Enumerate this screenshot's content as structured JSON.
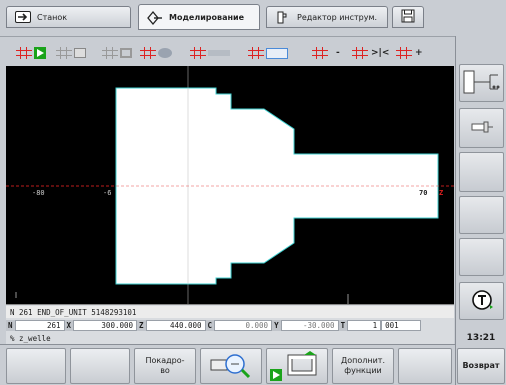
{
  "tabs": [
    {
      "label": "Станок"
    },
    {
      "label": "Моделирование"
    },
    {
      "label": "Редактор инструм."
    }
  ],
  "toolbar": {
    "items": [
      {
        "label": ""
      },
      {
        "label": ""
      },
      {
        "label": ""
      },
      {
        "label": ""
      },
      {
        "label": ""
      },
      {
        "label": ""
      },
      {
        "label": "-"
      },
      {
        "label": ">|<"
      },
      {
        "label": "+"
      }
    ]
  },
  "canvas": {
    "axis_left_label": "-80",
    "axis_mid_label": "-6",
    "axis_right_label": "70",
    "axis_z_label": "Z"
  },
  "status": {
    "line1": "N 261 END_OF_UNIT 5148293101",
    "n_label": "N",
    "n_value": "261",
    "x_label": "X",
    "x_value": "300.000",
    "z_label": "Z",
    "z_value": "440.000",
    "c_label": "C",
    "c_value": "0.000",
    "y_label": "Y",
    "y_value": "-30.000",
    "t_label": "T",
    "t_value": "1",
    "t_extra": "001",
    "line3": "% z_welle"
  },
  "softkeys": {
    "frame_by_frame": "Покадро-\nво",
    "extra_functions": "Дополнит.\nфункции",
    "back": "Возврат"
  },
  "clock": "13:21",
  "colors": {
    "workpiece": "#ffffff",
    "contour": "#3fd1d1",
    "axis_red": "#e02020",
    "accent_green": "#1aa31a"
  }
}
